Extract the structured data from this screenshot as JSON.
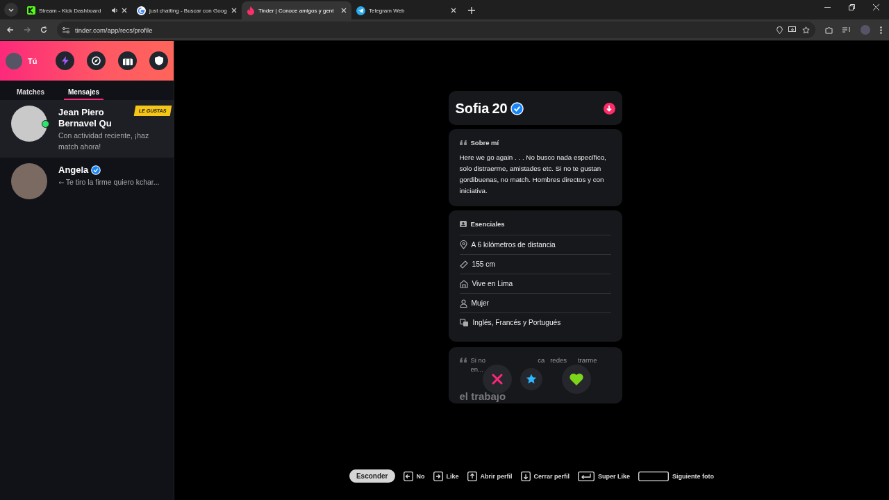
{
  "browser": {
    "tabs": [
      {
        "title": "Stream - Kick Dashboard",
        "kind": "kick",
        "audio": true,
        "selected": false
      },
      {
        "title": "just chatting - Buscar con Goog",
        "kind": "google",
        "audio": false,
        "selected": false
      },
      {
        "title": "Tinder | Conoce amigos y gent",
        "kind": "tinder",
        "audio": false,
        "selected": true
      },
      {
        "title": "Telegram Web",
        "kind": "telegram",
        "audio": false,
        "selected": false
      }
    ],
    "url": "tinder.com/app/recs/profile"
  },
  "sidebar": {
    "user": "Tú",
    "tabs": [
      {
        "label": "Matches",
        "selected": false
      },
      {
        "label": "Mensajes",
        "selected": true
      }
    ],
    "conversations": [
      {
        "name": "Jean Piero Bernavel Qu",
        "message": "Con actividad reciente, ¡haz match ahora!",
        "badge": "LE GUSTAS",
        "online": true,
        "verified": false,
        "replied": false,
        "selected": true
      },
      {
        "name": "Angela",
        "message": "Te tiro la firme quiero kchar...",
        "online": false,
        "verified": true,
        "replied": true,
        "selected": false
      }
    ]
  },
  "profile": {
    "name": "Sofia",
    "age": "20",
    "verified": true,
    "about": {
      "title": "Sobre mí",
      "text": "Here we go again . . . No busco nada específico, solo distraerme, amistades etc. Si no te gustan gordibuenas, no match. Hombres directos y con iniciativa."
    },
    "essentials": {
      "title": "Esenciales",
      "items": [
        {
          "kind": "distance",
          "text": "A 6 kilómetros de distancia"
        },
        {
          "kind": "height",
          "text": "155 cm"
        },
        {
          "kind": "home",
          "text": "Vive en Lima"
        },
        {
          "kind": "gender",
          "text": "Mujer"
        },
        {
          "kind": "languages",
          "text": "Inglés, Francés y Portugués"
        }
      ]
    },
    "teaser": {
      "line_1": [
        "Si no",
        "ca",
        "redes",
        "trarme"
      ],
      "line_2": "en...",
      "big_text": "el trabajo"
    }
  },
  "shortcuts": {
    "hide_button": "Esconder",
    "items": [
      {
        "kind": "left",
        "label": "No"
      },
      {
        "kind": "right",
        "label": "Like"
      },
      {
        "kind": "up",
        "label": "Abrir perfil"
      },
      {
        "kind": "down",
        "label": "Cerrar perfil"
      },
      {
        "kind": "enter",
        "label": "Super Like"
      },
      {
        "kind": "space",
        "label": "Siguiente foto"
      }
    ]
  }
}
